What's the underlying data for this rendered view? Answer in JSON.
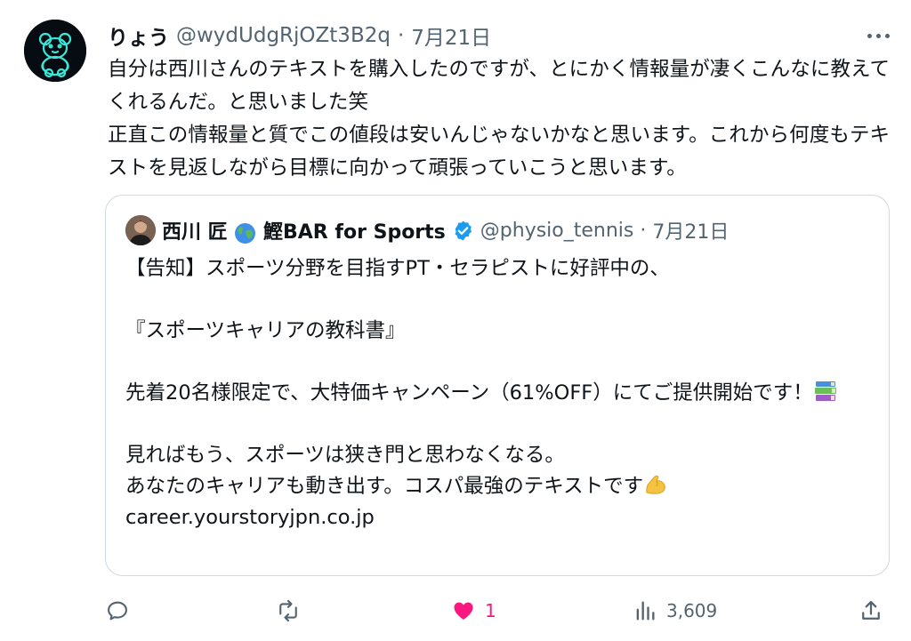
{
  "tweet": {
    "author_name": "りょう",
    "author_handle": "@wydUdgRjOZt3B2q",
    "separator": "·",
    "date": "7月21日",
    "text": "自分は西川さんのテキストを購入したのですが、とにかく情報量が凄くこんなに教えてくれるんだ。と思いました笑\n正直この情報量と質でこの値段は安いんじゃないかなと思います。これから何度もテキストを見返しながら目標に向かって頑張っていこうと思います。"
  },
  "quoted_tweet": {
    "author_name": "西川 匠",
    "author_name_suffix": "鰹BAR for Sports",
    "author_handle": "@physio_tennis",
    "separator": "·",
    "date": "7月21日",
    "text_part1": "【告知】スポーツ分野を目指すPT・セラピストに好評中の、\n\n『スポーツキャリアの教科書』\n\n先着20名様限定で、大特価キャンペーン（61%OFF）にてご提供開始です！",
    "text_part2": "\n\n見ればもう、スポーツは狭き門と思わなくなる。\nあなたのキャリアも動き出す。コスパ最強のテキストです",
    "link": "career.yourstoryjpn.co.jp",
    "emoji_books": "books-emoji",
    "emoji_muscle": "flexed-biceps-emoji"
  },
  "actions": {
    "reply_icon": "reply-icon",
    "retweet_icon": "retweet-icon",
    "like_icon": "heart-icon",
    "like_count": "1",
    "views_icon": "views-bar-chart-icon",
    "views_count": "3,609",
    "share_icon": "share-icon"
  },
  "colors": {
    "text": "#0f1419",
    "secondary": "#536471",
    "like": "#f91880",
    "verified": "#1d9bf0",
    "border": "#cfd9de"
  }
}
